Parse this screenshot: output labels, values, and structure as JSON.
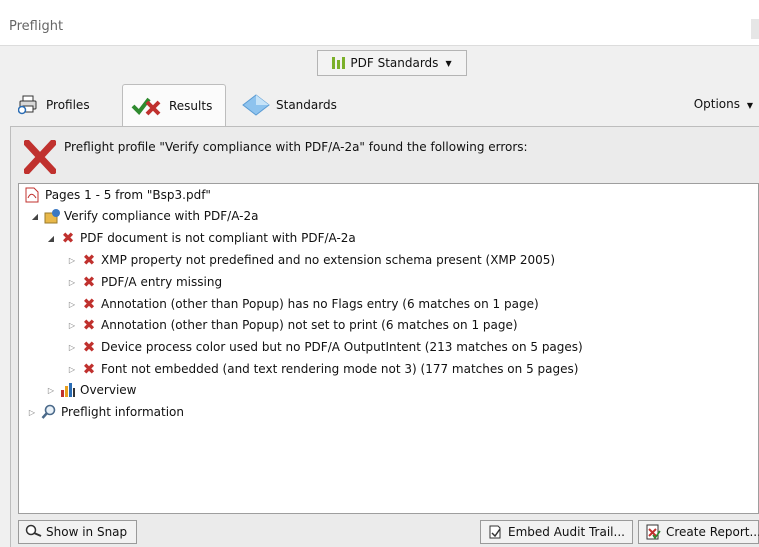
{
  "window": {
    "title": "Preflight"
  },
  "standards_button": {
    "label": "PDF Standards",
    "icon": "bar-chart-icon"
  },
  "tabs": [
    {
      "label": "Profiles",
      "icon": "printer-icon",
      "active": false
    },
    {
      "label": "Results",
      "icon": "checkmark-x-icon",
      "active": true
    },
    {
      "label": "Standards",
      "icon": "diamond-icon",
      "active": false
    }
  ],
  "options_label": "Options",
  "header_message": "Preflight profile \"Verify compliance with PDF/A-2a\" found the following errors:",
  "tree": {
    "root": "Pages 1 - 5 from \"Bsp3.pdf\"",
    "profile": "Verify compliance with PDF/A-2a",
    "error_group": "PDF document is not compliant with PDF/A-2a",
    "errors": [
      "XMP property not predefined and no extension schema present (XMP 2005)",
      "PDF/A entry missing",
      "Annotation (other than Popup) has no Flags entry (6 matches on 1 page)",
      "Annotation (other than Popup) not set to print (6 matches on 1 page)",
      "Device process color used but no PDF/A OutputIntent (213 matches on 5 pages)",
      "Font not embedded (and text rendering mode not 3) (177 matches on 5 pages)"
    ],
    "overview": "Overview",
    "preflight_info": "Preflight information"
  },
  "buttons": {
    "show_in_snap": "Show in Snap",
    "embed_audit_trail": "Embed Audit Trail...",
    "create_report": "Create Report..."
  },
  "colors": {
    "error_red": "#c0312e",
    "accent_green": "#7bb02a"
  }
}
